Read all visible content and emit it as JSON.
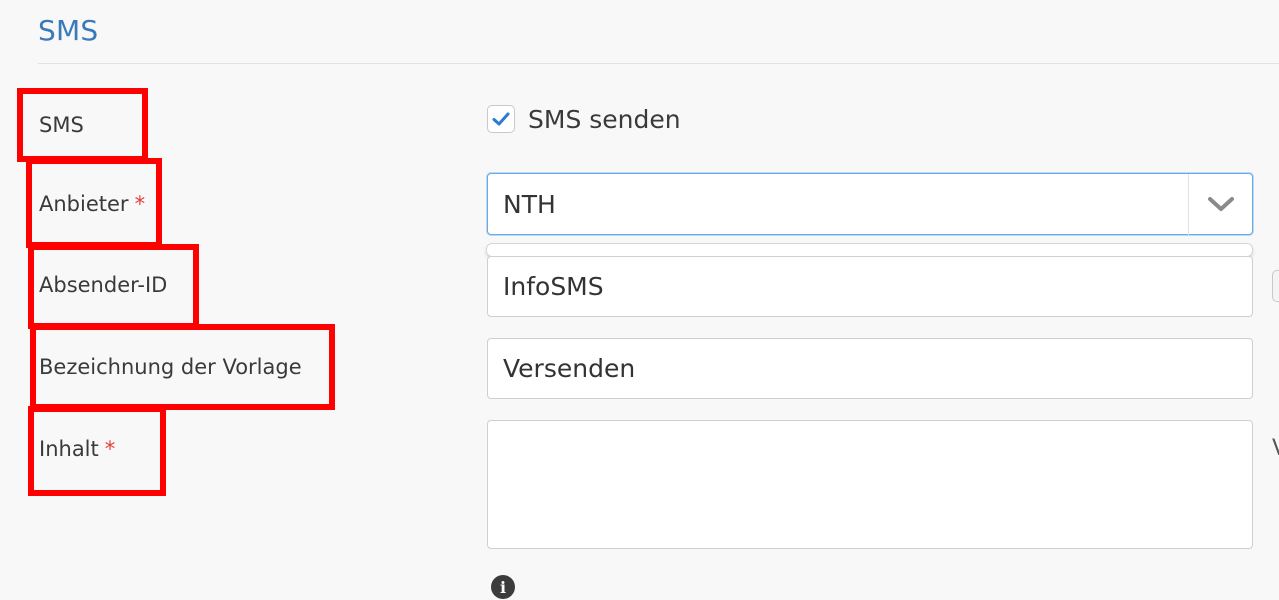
{
  "section": {
    "title": "SMS"
  },
  "form": {
    "sms_label": "SMS",
    "send_sms": {
      "label": "SMS senden",
      "checked": true
    },
    "provider": {
      "label": "Anbieter",
      "required_marker": "*",
      "value": "NTH"
    },
    "sender_id": {
      "label": "Absender-ID",
      "value": "InfoSMS"
    },
    "template_name": {
      "label": "Bezeichnung der Vorlage",
      "value": "Versenden"
    },
    "content": {
      "label": "Inhalt",
      "required_marker": "*",
      "value": ""
    },
    "side_text": "V"
  },
  "colors": {
    "accent": "#3a7ab8",
    "checkmark": "#2b7bd0",
    "required": "#e2403a",
    "highlight_box": "#ff0000"
  },
  "icons": {
    "checkbox": "checkmark-icon",
    "select": "chevron-down-icon",
    "info": "info-icon"
  }
}
